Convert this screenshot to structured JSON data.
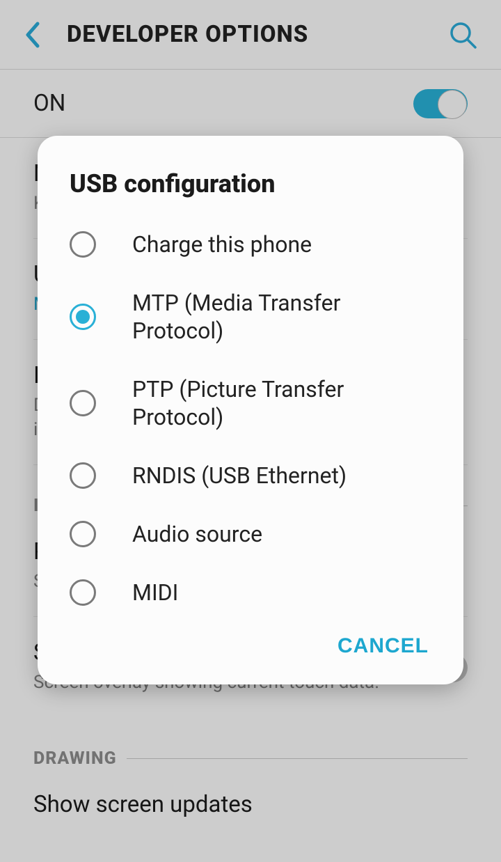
{
  "header": {
    "title": "DEVELOPER OPTIONS"
  },
  "master": {
    "label": "ON",
    "on": true
  },
  "items": {
    "networking": {
      "title": "Networking",
      "subtitle": "Keep mobile data turned on even when Wi-Fi is active."
    },
    "usb": {
      "title": "USB configuration",
      "subtitle": "MTP (Media Transfer Protocol)"
    },
    "input_item": {
      "title": "Input",
      "subtitle": "Display input methods for hardware keyboard. Verify input."
    },
    "pointer": {
      "title": "Pointer location",
      "subtitle": "Screen overlay showing current pointer data."
    },
    "touches": {
      "title": "Show touches",
      "subtitle": "Screen overlay showing current touch data."
    },
    "updates": {
      "title": "Show screen updates"
    }
  },
  "sections": {
    "input": {
      "label": "INPUT"
    },
    "drawing": {
      "label": "DRAWING"
    }
  },
  "dialog": {
    "title": "USB configuration",
    "options": [
      "Charge this phone",
      "MTP (Media Transfer Protocol)",
      "PTP (Picture Transfer Protocol)",
      "RNDIS (USB Ethernet)",
      "Audio source",
      "MIDI"
    ],
    "selected_index": 1,
    "cancel": "CANCEL"
  }
}
